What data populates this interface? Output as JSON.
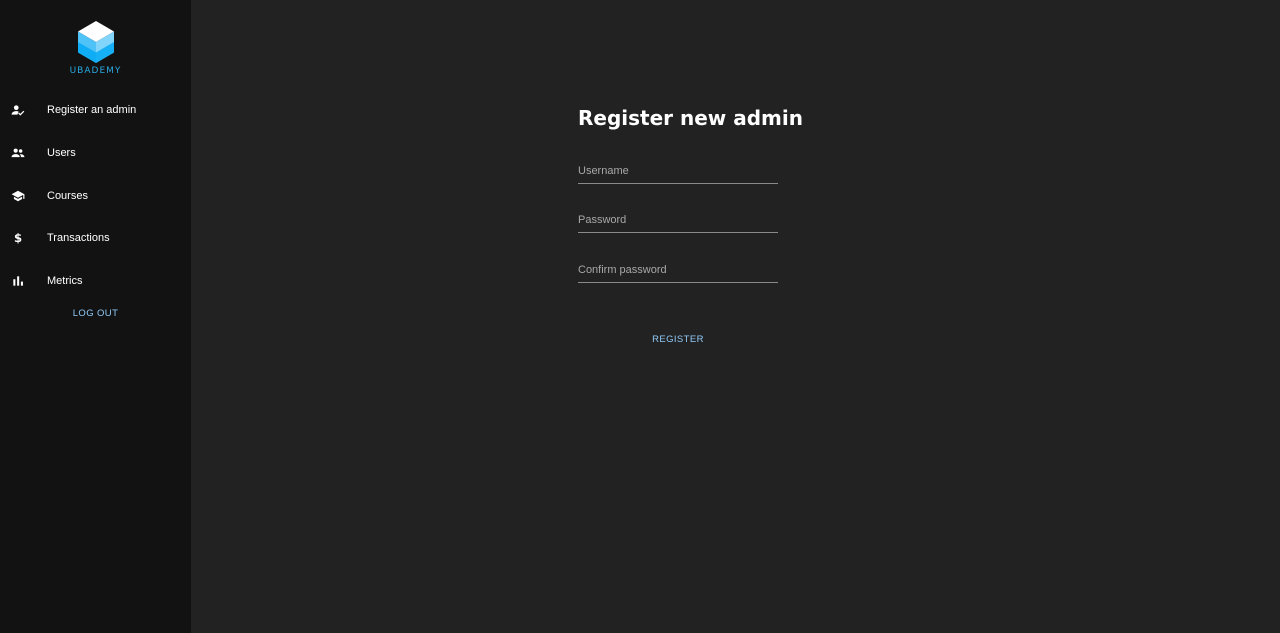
{
  "brand": {
    "name": "UBADEMY",
    "color": "#29a7e0"
  },
  "sidebar": {
    "items": [
      {
        "label": "Register an admin",
        "icon": "person-check-icon"
      },
      {
        "label": "Users",
        "icon": "people-icon"
      },
      {
        "label": "Courses",
        "icon": "graduation-cap-icon"
      },
      {
        "label": "Transactions",
        "icon": "dollar-icon"
      },
      {
        "label": "Metrics",
        "icon": "bar-chart-icon"
      }
    ],
    "logout_label": "LOG OUT"
  },
  "form": {
    "title": "Register new admin",
    "fields": {
      "username": {
        "placeholder": "Username",
        "value": ""
      },
      "password": {
        "placeholder": "Password",
        "value": ""
      },
      "confirm": {
        "placeholder": "Confirm password",
        "value": ""
      }
    },
    "submit_label": "REGISTER"
  },
  "colors": {
    "sidebar_bg": "#121212",
    "main_bg": "#222222",
    "accent": "#90caf9"
  }
}
